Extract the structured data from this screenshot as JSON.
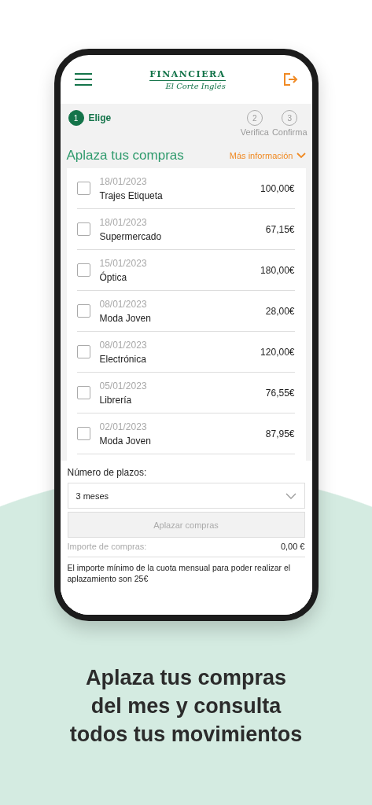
{
  "header": {
    "brand": "FINANCIERA",
    "sub_brand": "El Corte Inglés"
  },
  "steps": [
    {
      "number": "1",
      "label": "Elige",
      "selected": true
    },
    {
      "number": "2",
      "label": "Verifica",
      "selected": false
    },
    {
      "number": "3",
      "label": "Confirma",
      "selected": false
    }
  ],
  "title": "Aplaza tus compras",
  "more_info": "Más información",
  "purchases": [
    {
      "date": "18/01/2023",
      "name": "Trajes Etiqueta",
      "amount": "100,00€",
      "checked": false
    },
    {
      "date": "18/01/2023",
      "name": "Supermercado",
      "amount": "67,15€",
      "checked": false
    },
    {
      "date": "15/01/2023",
      "name": "Óptica",
      "amount": "180,00€",
      "checked": false
    },
    {
      "date": "08/01/2023",
      "name": "Moda Joven",
      "amount": "28,00€",
      "checked": false
    },
    {
      "date": "08/01/2023",
      "name": "Electrónica",
      "amount": "120,00€",
      "checked": false
    },
    {
      "date": "05/01/2023",
      "name": "Librería",
      "amount": "76,55€",
      "checked": false
    },
    {
      "date": "02/01/2023",
      "name": "Moda Joven",
      "amount": "87,95€",
      "checked": false
    }
  ],
  "installments": {
    "label": "Número de plazos:",
    "value": "3 meses"
  },
  "submit": {
    "label": "Aplazar compras",
    "disabled": true
  },
  "total": {
    "label": "Importe de compras:",
    "value": "0,00 €"
  },
  "note": "El importe mínimo de la cuota mensual para poder realizar el aplazamiento son 25€",
  "caption": [
    "Aplaza tus compras",
    "del mes y consulta",
    "todos tus movimientos"
  ]
}
